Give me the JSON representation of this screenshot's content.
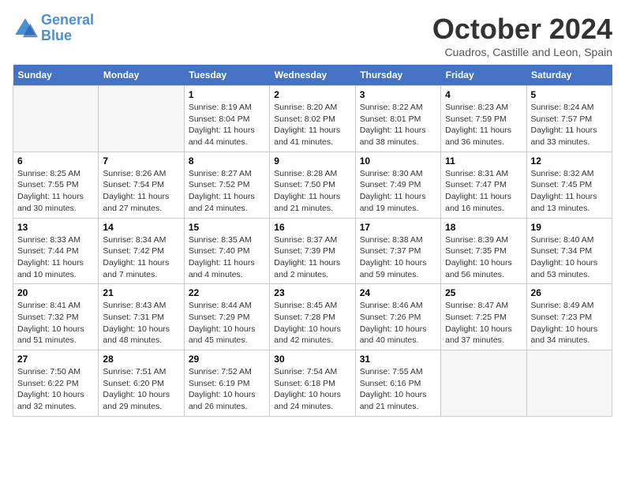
{
  "header": {
    "logo_line1": "General",
    "logo_line2": "Blue",
    "month": "October 2024",
    "location": "Cuadros, Castille and Leon, Spain"
  },
  "days_of_week": [
    "Sunday",
    "Monday",
    "Tuesday",
    "Wednesday",
    "Thursday",
    "Friday",
    "Saturday"
  ],
  "weeks": [
    [
      {
        "day": "",
        "empty": true
      },
      {
        "day": "",
        "empty": true
      },
      {
        "day": "1",
        "sunrise": "8:19 AM",
        "sunset": "8:04 PM",
        "daylight": "11 hours and 44 minutes."
      },
      {
        "day": "2",
        "sunrise": "8:20 AM",
        "sunset": "8:02 PM",
        "daylight": "11 hours and 41 minutes."
      },
      {
        "day": "3",
        "sunrise": "8:22 AM",
        "sunset": "8:01 PM",
        "daylight": "11 hours and 38 minutes."
      },
      {
        "day": "4",
        "sunrise": "8:23 AM",
        "sunset": "7:59 PM",
        "daylight": "11 hours and 36 minutes."
      },
      {
        "day": "5",
        "sunrise": "8:24 AM",
        "sunset": "7:57 PM",
        "daylight": "11 hours and 33 minutes."
      }
    ],
    [
      {
        "day": "6",
        "sunrise": "8:25 AM",
        "sunset": "7:55 PM",
        "daylight": "11 hours and 30 minutes."
      },
      {
        "day": "7",
        "sunrise": "8:26 AM",
        "sunset": "7:54 PM",
        "daylight": "11 hours and 27 minutes."
      },
      {
        "day": "8",
        "sunrise": "8:27 AM",
        "sunset": "7:52 PM",
        "daylight": "11 hours and 24 minutes."
      },
      {
        "day": "9",
        "sunrise": "8:28 AM",
        "sunset": "7:50 PM",
        "daylight": "11 hours and 21 minutes."
      },
      {
        "day": "10",
        "sunrise": "8:30 AM",
        "sunset": "7:49 PM",
        "daylight": "11 hours and 19 minutes."
      },
      {
        "day": "11",
        "sunrise": "8:31 AM",
        "sunset": "7:47 PM",
        "daylight": "11 hours and 16 minutes."
      },
      {
        "day": "12",
        "sunrise": "8:32 AM",
        "sunset": "7:45 PM",
        "daylight": "11 hours and 13 minutes."
      }
    ],
    [
      {
        "day": "13",
        "sunrise": "8:33 AM",
        "sunset": "7:44 PM",
        "daylight": "11 hours and 10 minutes."
      },
      {
        "day": "14",
        "sunrise": "8:34 AM",
        "sunset": "7:42 PM",
        "daylight": "11 hours and 7 minutes."
      },
      {
        "day": "15",
        "sunrise": "8:35 AM",
        "sunset": "7:40 PM",
        "daylight": "11 hours and 4 minutes."
      },
      {
        "day": "16",
        "sunrise": "8:37 AM",
        "sunset": "7:39 PM",
        "daylight": "11 hours and 2 minutes."
      },
      {
        "day": "17",
        "sunrise": "8:38 AM",
        "sunset": "7:37 PM",
        "daylight": "10 hours and 59 minutes."
      },
      {
        "day": "18",
        "sunrise": "8:39 AM",
        "sunset": "7:35 PM",
        "daylight": "10 hours and 56 minutes."
      },
      {
        "day": "19",
        "sunrise": "8:40 AM",
        "sunset": "7:34 PM",
        "daylight": "10 hours and 53 minutes."
      }
    ],
    [
      {
        "day": "20",
        "sunrise": "8:41 AM",
        "sunset": "7:32 PM",
        "daylight": "10 hours and 51 minutes."
      },
      {
        "day": "21",
        "sunrise": "8:43 AM",
        "sunset": "7:31 PM",
        "daylight": "10 hours and 48 minutes."
      },
      {
        "day": "22",
        "sunrise": "8:44 AM",
        "sunset": "7:29 PM",
        "daylight": "10 hours and 45 minutes."
      },
      {
        "day": "23",
        "sunrise": "8:45 AM",
        "sunset": "7:28 PM",
        "daylight": "10 hours and 42 minutes."
      },
      {
        "day": "24",
        "sunrise": "8:46 AM",
        "sunset": "7:26 PM",
        "daylight": "10 hours and 40 minutes."
      },
      {
        "day": "25",
        "sunrise": "8:47 AM",
        "sunset": "7:25 PM",
        "daylight": "10 hours and 37 minutes."
      },
      {
        "day": "26",
        "sunrise": "8:49 AM",
        "sunset": "7:23 PM",
        "daylight": "10 hours and 34 minutes."
      }
    ],
    [
      {
        "day": "27",
        "sunrise": "7:50 AM",
        "sunset": "6:22 PM",
        "daylight": "10 hours and 32 minutes."
      },
      {
        "day": "28",
        "sunrise": "7:51 AM",
        "sunset": "6:20 PM",
        "daylight": "10 hours and 29 minutes."
      },
      {
        "day": "29",
        "sunrise": "7:52 AM",
        "sunset": "6:19 PM",
        "daylight": "10 hours and 26 minutes."
      },
      {
        "day": "30",
        "sunrise": "7:54 AM",
        "sunset": "6:18 PM",
        "daylight": "10 hours and 24 minutes."
      },
      {
        "day": "31",
        "sunrise": "7:55 AM",
        "sunset": "6:16 PM",
        "daylight": "10 hours and 21 minutes."
      },
      {
        "day": "",
        "empty": true
      },
      {
        "day": "",
        "empty": true
      }
    ]
  ],
  "labels": {
    "sunrise": "Sunrise: ",
    "sunset": "Sunset: ",
    "daylight": "Daylight: "
  }
}
